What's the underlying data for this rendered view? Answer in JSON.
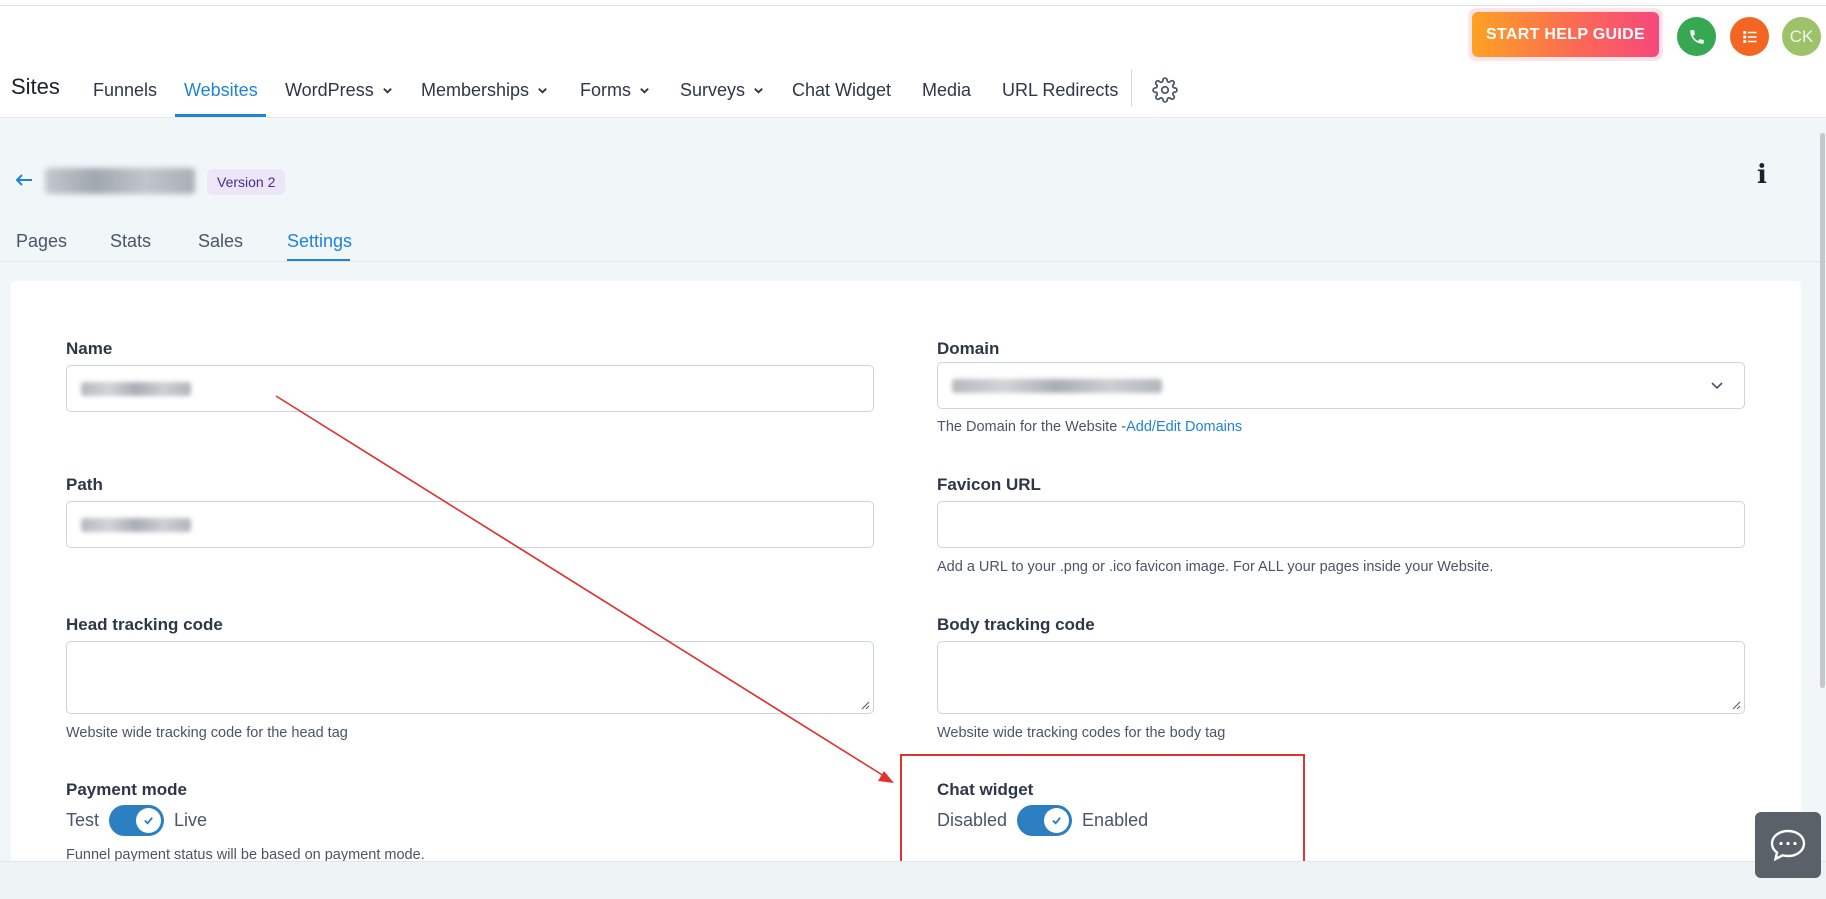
{
  "header": {
    "help_button": "START HELP GUIDE",
    "avatar_initials": "CK",
    "app_title": "Sites",
    "nav": [
      {
        "label": "Funnels"
      },
      {
        "label": "Websites"
      },
      {
        "label": "WordPress"
      },
      {
        "label": "Memberships"
      },
      {
        "label": "Forms"
      },
      {
        "label": "Surveys"
      },
      {
        "label": "Chat Widget"
      },
      {
        "label": "Media"
      },
      {
        "label": "URL Redirects"
      }
    ],
    "active_nav": "Websites"
  },
  "site": {
    "version_badge": "Version 2",
    "info_symbol": "i",
    "tabs": [
      {
        "label": "Pages"
      },
      {
        "label": "Stats"
      },
      {
        "label": "Sales"
      },
      {
        "label": "Settings"
      }
    ],
    "active_tab": "Settings"
  },
  "form": {
    "name_label": "Name",
    "domain_label": "Domain",
    "domain_help_prefix": "The Domain for the Website -",
    "domain_help_link": "Add/Edit Domains",
    "path_label": "Path",
    "favicon_label": "Favicon URL",
    "favicon_help": "Add a URL to your .png or .ico favicon image. For ALL your pages inside your Website.",
    "head_label": "Head tracking code",
    "head_help": "Website wide tracking code for the head tag",
    "body_label": "Body tracking code",
    "body_help": "Website wide tracking codes for the body tag",
    "payment_label": "Payment mode",
    "payment_off": "Test",
    "payment_on": "Live",
    "payment_enabled": true,
    "payment_help": "Funnel payment status will be based on payment mode.",
    "chat_label": "Chat widget",
    "chat_off": "Disabled",
    "chat_on": "Enabled",
    "chat_enabled": true
  },
  "colors": {
    "accent": "#1f84d6",
    "toggle": "#2c7fc1",
    "annotation": "#e0342f",
    "phone_button": "#36a852",
    "list_button": "#f26522",
    "avatar": "#9ec26a"
  },
  "icons": [
    "phone-icon",
    "list-icon",
    "chevron-down-icon",
    "gear-icon",
    "back-arrow-icon",
    "info-icon",
    "check-icon",
    "chat-icon"
  ]
}
